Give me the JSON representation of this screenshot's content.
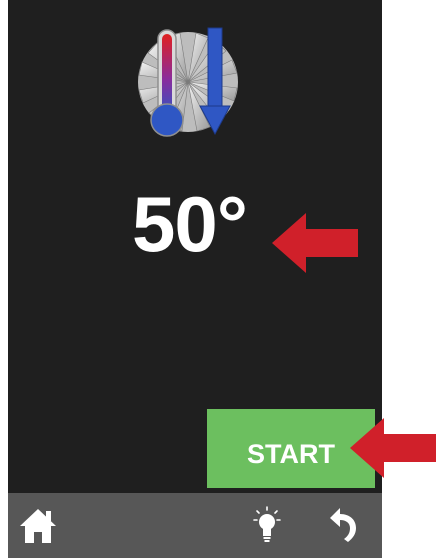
{
  "screen": {
    "icon": "fan-thermometer-cooling-icon",
    "temperature": "50°",
    "start_label": "START"
  },
  "bottom_bar": {
    "icons": [
      "home-icon",
      "lightbulb-icon",
      "back-arrow-icon"
    ]
  },
  "annotations": {
    "arrow_color": "#d0202a"
  },
  "colors": {
    "screen_background": "#1f1f1f",
    "start_button": "#6cbf5f",
    "bottom_bar": "#575757",
    "text": "#ffffff"
  }
}
